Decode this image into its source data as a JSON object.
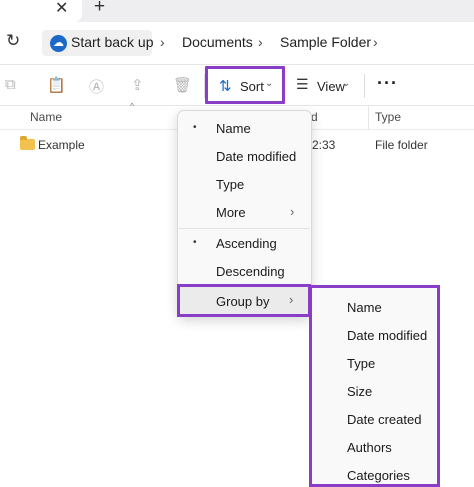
{
  "tabs": {
    "close_icon": "close-icon",
    "new_tab_icon": "plus-icon",
    "close_glyph": "✕",
    "new_tab_glyph": "+"
  },
  "address": {
    "refresh_glyph": "↻",
    "crumbs": [
      "Start back up",
      "Documents",
      "Sample Folder"
    ],
    "separator": "›"
  },
  "toolbar": {
    "sort_label": "Sort",
    "view_label": "View",
    "more_glyph": "···",
    "chevron": "⌄",
    "accent_color": "#8a3ec8"
  },
  "columns": {
    "name": "Name",
    "date": "d",
    "type": "Type"
  },
  "files": [
    {
      "name": "Example",
      "time": "2:33",
      "type": "File folder"
    }
  ],
  "sort_menu": {
    "items": [
      {
        "label": "Name",
        "selected": true
      },
      {
        "label": "Date modified",
        "selected": false
      },
      {
        "label": "Type",
        "selected": false
      },
      {
        "label": "More",
        "selected": false,
        "has_submenu": true
      },
      {
        "label": "Ascending",
        "selected": true
      },
      {
        "label": "Descending",
        "selected": false
      },
      {
        "label": "Group by",
        "selected": false,
        "has_submenu": true
      }
    ],
    "bullet": "•",
    "submenu_chevron": "›"
  },
  "group_by_menu": {
    "items": [
      "Name",
      "Date modified",
      "Type",
      "Size",
      "Date created",
      "Authors",
      "Categories"
    ]
  }
}
